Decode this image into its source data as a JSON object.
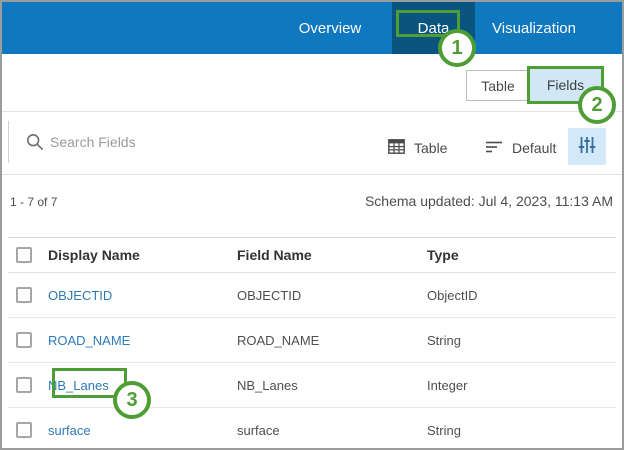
{
  "colors": {
    "nav_bar": "#0f78be",
    "nav_active_tab": "#0a5480",
    "annotation_green": "#4f9e35",
    "selected_light_blue": "#d2e7f6",
    "link_blue": "#2e7ab8"
  },
  "nav": {
    "tabs": [
      {
        "label": "Overview",
        "active": false
      },
      {
        "label": "Data",
        "active": true
      },
      {
        "label": "Visualization",
        "active": false
      }
    ]
  },
  "view_toggle": {
    "options": [
      {
        "label": "Table",
        "selected": false
      },
      {
        "label": "Fields",
        "selected": true
      }
    ]
  },
  "toolbar": {
    "search_placeholder": "Search Fields",
    "table_view_label": "Table",
    "sort_label": "Default"
  },
  "status": {
    "count": "1 - 7 of 7",
    "schema_updated": "Schema updated: Jul 4, 2023, 11:13 AM"
  },
  "table": {
    "columns": [
      "Display Name",
      "Field Name",
      "Type"
    ],
    "rows": [
      {
        "display_name": "OBJECTID",
        "field_name": "OBJECTID",
        "type": "ObjectID"
      },
      {
        "display_name": "ROAD_NAME",
        "field_name": "ROAD_NAME",
        "type": "String"
      },
      {
        "display_name": "NB_Lanes",
        "field_name": "NB_Lanes",
        "type": "Integer"
      },
      {
        "display_name": "surface",
        "field_name": "surface",
        "type": "String"
      }
    ]
  },
  "annotations": [
    "1",
    "2",
    "3"
  ]
}
